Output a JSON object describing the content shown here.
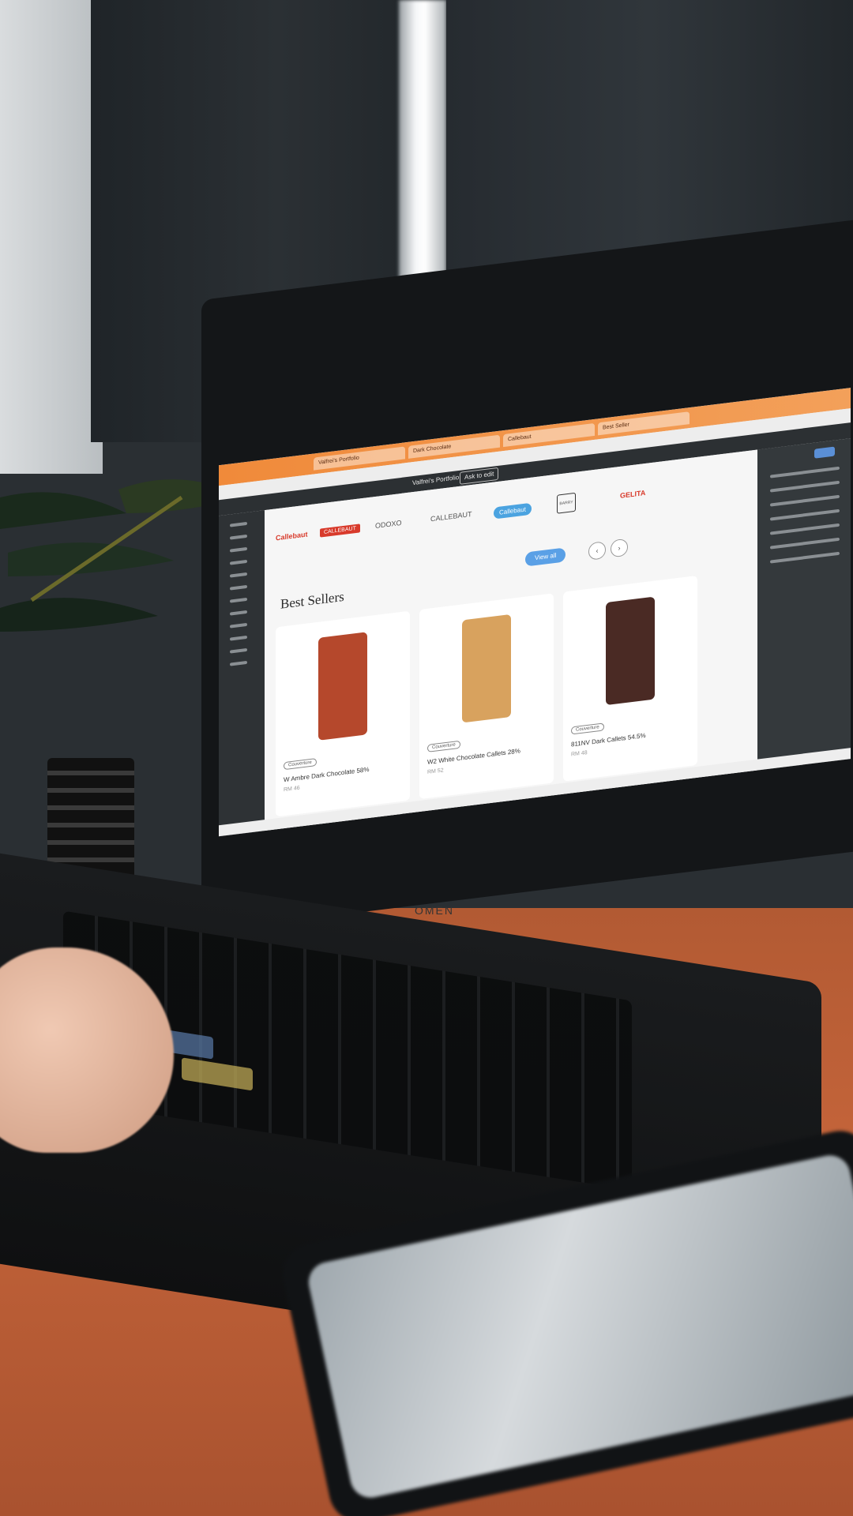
{
  "scene": {
    "description_colors": {
      "browser_accent": "#f08a3a",
      "desk": "#c4643a",
      "view_all_button": "#5aa0e6"
    },
    "laptop_logo": "OMEN"
  },
  "browser": {
    "tabs": [
      "Valfrei's Portfolio",
      "Dark Chocolate",
      "Callebaut",
      "Best Seller"
    ],
    "toolbar": {
      "portfolio_label": "Valfrei's Portfolio",
      "ask_button": "Ask to edit"
    }
  },
  "website": {
    "brands": [
      "Callebaut",
      "CALLEBAUT",
      "ODOXO",
      "CALLEBAUT",
      "Callebaut",
      "BARRY",
      "GELITA"
    ],
    "section_title": "Best Sellers",
    "view_all_label": "View all",
    "prev_icon": "chevron-left-icon",
    "next_icon": "chevron-right-icon",
    "products": [
      {
        "tag": "Couverture",
        "name": "W Ambre Dark Chocolate 58%",
        "price": "RM 46",
        "color": "#b5482c"
      },
      {
        "tag": "Couverture",
        "name": "W2 White Chocolate Callets 28%",
        "price": "RM 52",
        "color": "#d8a25e"
      },
      {
        "tag": "Couverture",
        "name": "811NV Dark Callets 54.5%",
        "price": "RM 48",
        "color": "#4a2a24"
      }
    ]
  }
}
